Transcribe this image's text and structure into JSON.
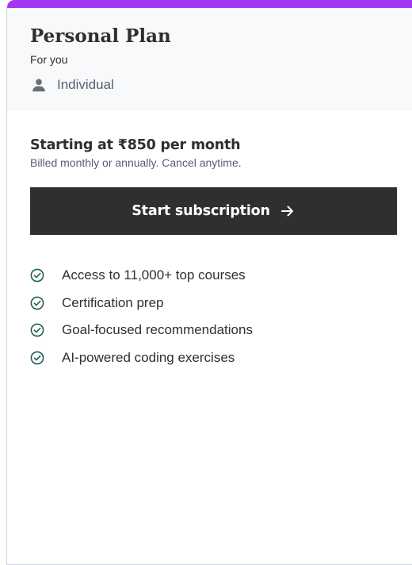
{
  "colors": {
    "accent": "#a435f0",
    "header_background": "#f7f9fa",
    "button_background": "#2d2f31",
    "check_color": "#1e6055"
  },
  "plan": {
    "title": "Personal Plan",
    "subtitle": "For you",
    "audience_icon": "person-icon",
    "audience": "Individual",
    "price": "Starting at ₹850 per month",
    "billing_note": "Billed monthly or annually. Cancel anytime.",
    "cta_label": "Start subscription",
    "cta_icon": "arrow-right-icon",
    "feature_icon": "check-circle-icon",
    "features": [
      "Access to 11,000+ top courses",
      "Certification prep",
      "Goal-focused recommendations",
      "AI-powered coding exercises"
    ]
  }
}
